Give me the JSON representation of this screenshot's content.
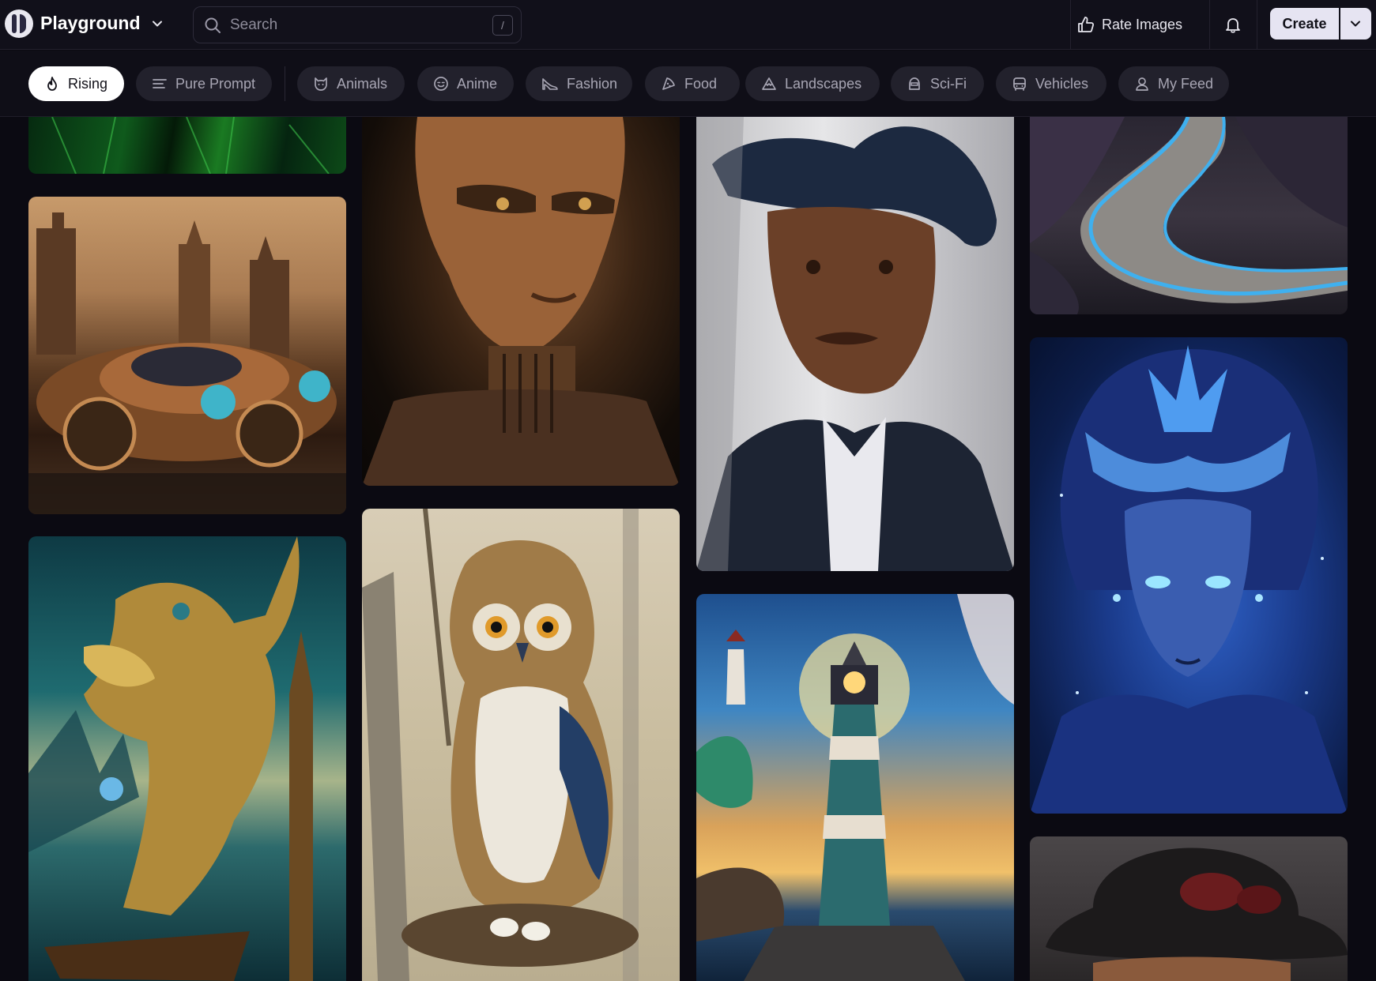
{
  "header": {
    "brand": "Playground",
    "search_placeholder": "Search",
    "search_shortcut": "/",
    "rate_label": "Rate Images",
    "create_label": "Create"
  },
  "categories": [
    {
      "label": "Rising",
      "icon": "flame-icon",
      "active": true
    },
    {
      "label": "Pure Prompt",
      "icon": "text-lines-icon",
      "active": false
    },
    {
      "label": "Animals",
      "icon": "cat-face-icon",
      "active": false
    },
    {
      "label": "Anime",
      "icon": "smile-face-icon",
      "active": false
    },
    {
      "label": "Fashion",
      "icon": "high-heel-icon",
      "active": false
    },
    {
      "label": "Food",
      "icon": "pizza-slice-icon",
      "active": false
    },
    {
      "label": "Landscapes",
      "icon": "mountain-icon",
      "active": false
    },
    {
      "label": "Sci-Fi",
      "icon": "astronaut-icon",
      "active": false
    },
    {
      "label": "Vehicles",
      "icon": "car-icon",
      "active": false
    },
    {
      "label": "My Feed",
      "icon": "user-icon",
      "active": false
    }
  ],
  "gallery": [
    {
      "name": "image-green-abstract"
    },
    {
      "name": "image-steampunk-car"
    },
    {
      "name": "image-dragon-creature"
    },
    {
      "name": "image-bronze-android-woman"
    },
    {
      "name": "image-owl-on-nest"
    },
    {
      "name": "image-man-in-hat-portrait"
    },
    {
      "name": "image-lighthouse-sunset"
    },
    {
      "name": "image-glowing-river"
    },
    {
      "name": "image-blue-goddess"
    },
    {
      "name": "image-dark-hat-figure"
    }
  ]
}
